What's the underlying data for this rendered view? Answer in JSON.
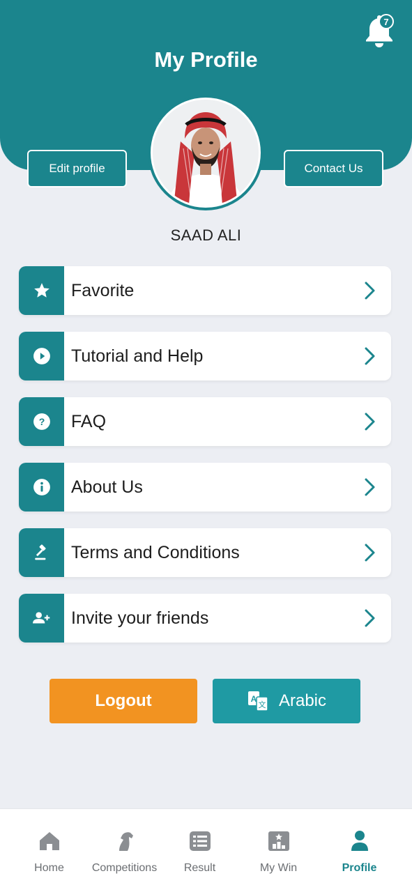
{
  "header": {
    "title": "My Profile",
    "notification_count": "7",
    "edit_profile_label": "Edit profile",
    "contact_us_label": "Contact Us"
  },
  "user": {
    "name": "SAAD ALI"
  },
  "menu": [
    {
      "label": "Favorite",
      "icon": "star-icon"
    },
    {
      "label": "Tutorial and Help",
      "icon": "play-circle-icon"
    },
    {
      "label": "FAQ",
      "icon": "question-circle-icon"
    },
    {
      "label": "About Us",
      "icon": "info-circle-icon"
    },
    {
      "label": "Terms and Conditions",
      "icon": "gavel-icon"
    },
    {
      "label": "Invite your friends",
      "icon": "user-plus-icon"
    }
  ],
  "actions": {
    "logout_label": "Logout",
    "language_label": "Arabic"
  },
  "bottom_nav": [
    {
      "label": "Home",
      "icon": "home-icon",
      "active": false
    },
    {
      "label": "Competitions",
      "icon": "horse-icon",
      "active": false
    },
    {
      "label": "Result",
      "icon": "list-icon",
      "active": false
    },
    {
      "label": "My Win",
      "icon": "trophy-board-icon",
      "active": false
    },
    {
      "label": "Profile",
      "icon": "person-icon",
      "active": true
    }
  ],
  "colors": {
    "primary": "#1b858d",
    "accent_orange": "#f29321",
    "language_button": "#1f9aa3",
    "background": "#eceef3"
  }
}
